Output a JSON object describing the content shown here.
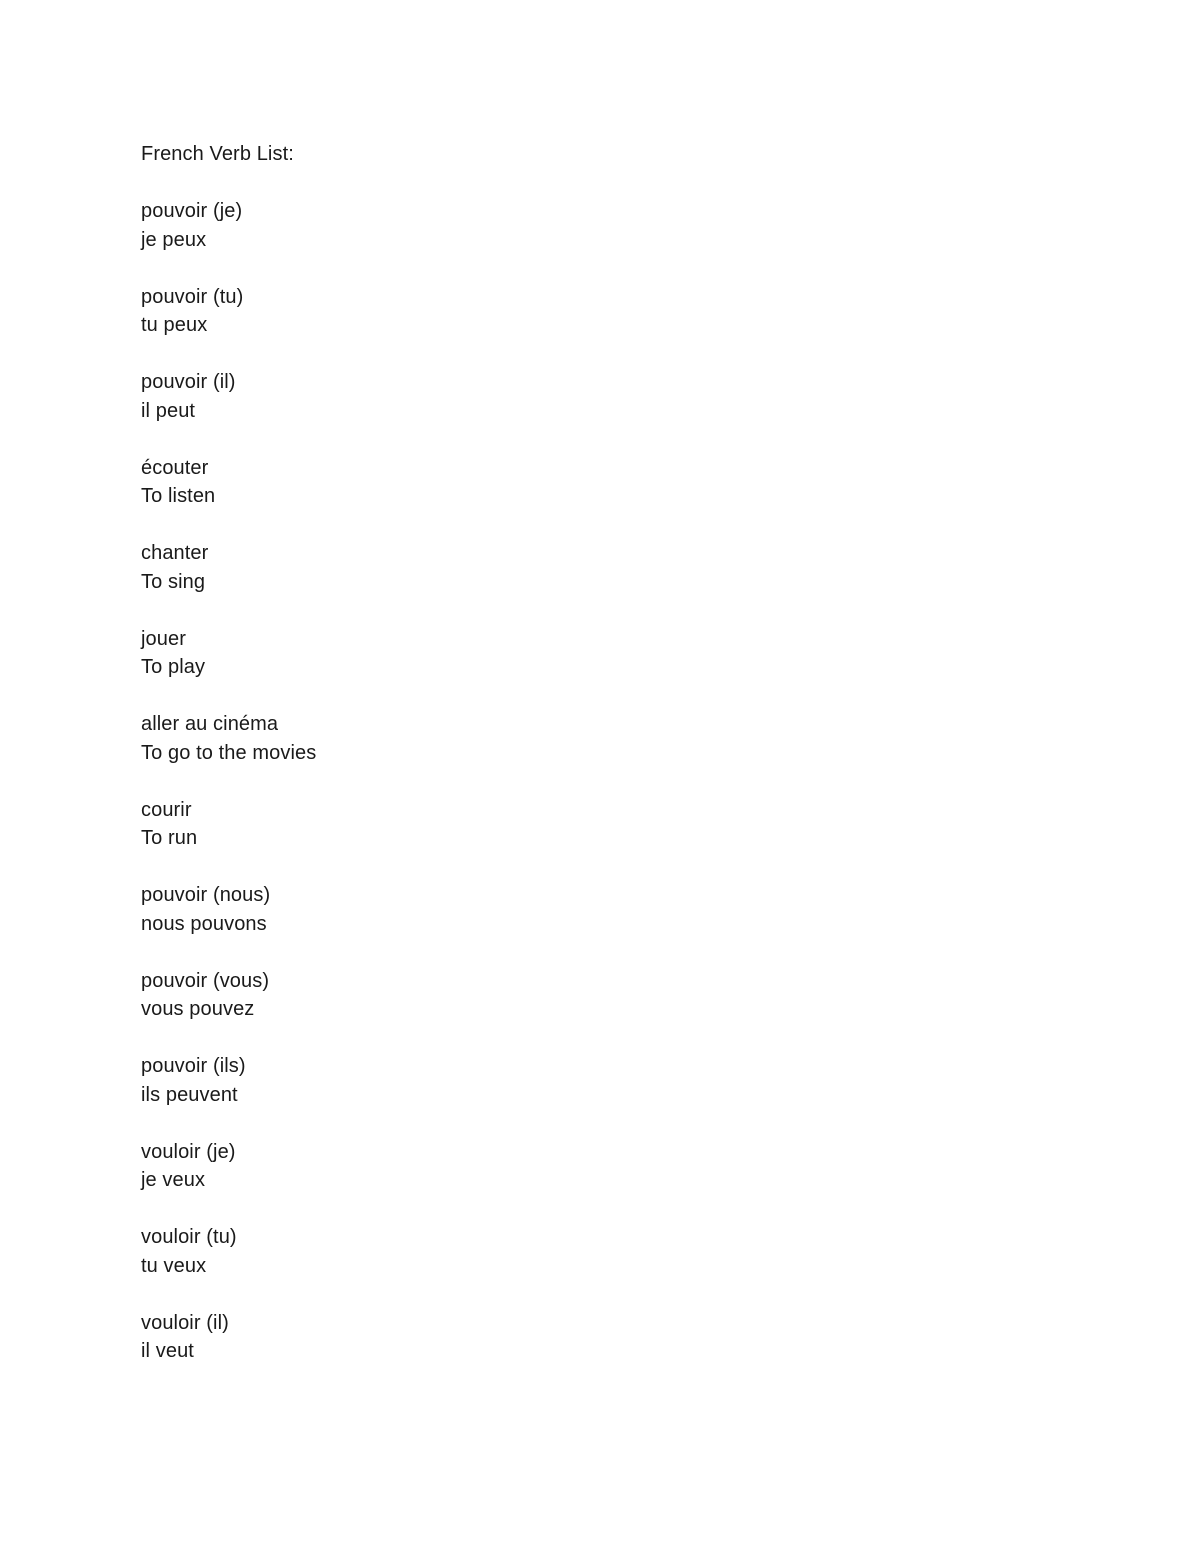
{
  "document": {
    "title": "French Verb List:",
    "entries": [
      {
        "term": "pouvoir (je)",
        "meaning": "je peux"
      },
      {
        "term": "pouvoir (tu)",
        "meaning": "tu peux"
      },
      {
        "term": "pouvoir (il)",
        "meaning": "il peut"
      },
      {
        "term": "écouter",
        "meaning": "To listen"
      },
      {
        "term": "chanter",
        "meaning": "To sing"
      },
      {
        "term": "jouer",
        "meaning": "To play"
      },
      {
        "term": "aller au cinéma",
        "meaning": "To go to the movies"
      },
      {
        "term": "courir",
        "meaning": "To run"
      },
      {
        "term": "pouvoir (nous)",
        "meaning": "nous pouvons"
      },
      {
        "term": "pouvoir (vous)",
        "meaning": "vous pouvez"
      },
      {
        "term": "pouvoir (ils)",
        "meaning": "ils peuvent"
      },
      {
        "term": "vouloir (je)",
        "meaning": "je veux"
      },
      {
        "term": "vouloir (tu)",
        "meaning": "tu veux"
      },
      {
        "term": "vouloir (il)",
        "meaning": "il veut"
      }
    ]
  }
}
